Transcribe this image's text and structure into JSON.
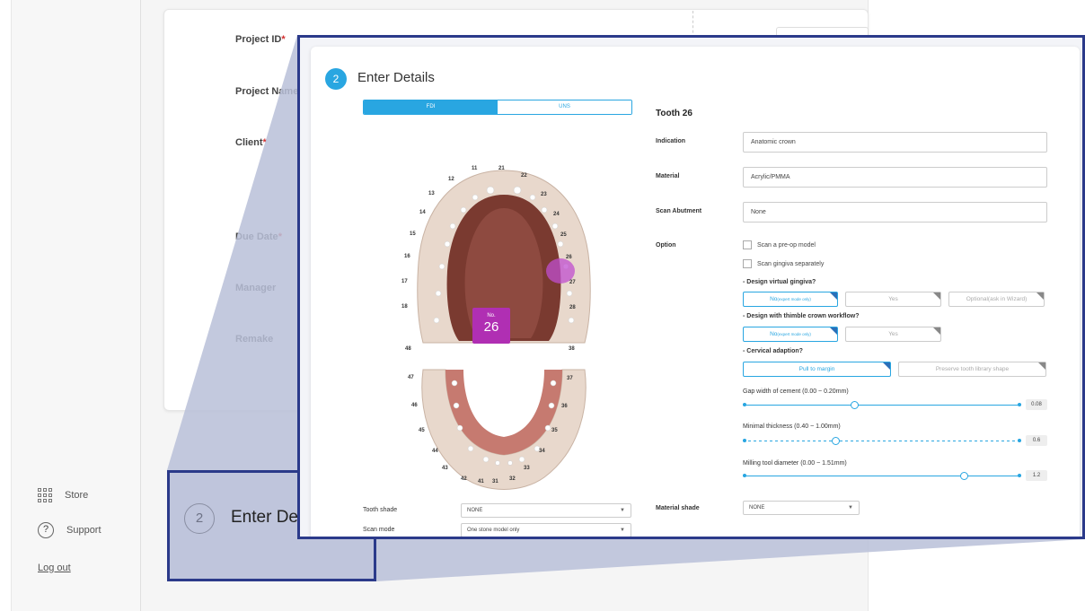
{
  "base": {
    "fields": {
      "project_id": "Project ID",
      "project_name": "Project Name",
      "client": "Client",
      "due_date": "Due Date",
      "manager": "Manager",
      "remake": "Remake",
      "required_mark": "*"
    },
    "sidebar": {
      "store": "Store",
      "support": "Support",
      "logout": "Log out"
    },
    "step_preview": {
      "number": "2",
      "title": "Enter Det"
    }
  },
  "zoom": {
    "step_number": "2",
    "step_title": "Enter Details",
    "notation_tabs": [
      "FDI",
      "UNS"
    ],
    "notation_selected": "FDI",
    "tooth_numbers": [
      "11",
      "21",
      "12",
      "22",
      "13",
      "23",
      "14",
      "24",
      "15",
      "25",
      "16",
      "26",
      "17",
      "27",
      "18",
      "28",
      "48",
      "38",
      "47",
      "37",
      "46",
      "36",
      "45",
      "35",
      "44",
      "34",
      "43",
      "33",
      "42",
      "41",
      "31",
      "32"
    ],
    "selected_badge": {
      "label": "No.",
      "value": "26"
    },
    "tooth_title": "Tooth 26",
    "indication": {
      "label": "Indication",
      "value": "Anatomic crown"
    },
    "material": {
      "label": "Material",
      "value": "Acrylic/PMMA"
    },
    "scan_abutment": {
      "label": "Scan Abutment",
      "value": "None"
    },
    "option": {
      "label": "Option",
      "checkboxes": [
        "Scan a pre-op model",
        "Scan gingiva separately"
      ],
      "virtual_gingiva": {
        "question": "- Design virtual gingiva?",
        "no": "No",
        "no_note": "(expert mode only)",
        "yes": "Yes",
        "optional": "Optional(ask in Wizard)"
      },
      "thimble": {
        "question": "- Design with thimble crown workflow?",
        "no": "No",
        "no_note": "(expert mode only)",
        "yes": "Yes"
      },
      "cervical": {
        "question": "- Cervical adaption?",
        "pull": "Pull to margin",
        "preserve": "Preserve tooth library shape"
      }
    },
    "sliders": [
      {
        "label": "Gap width of cement (0.00 ~ 0.20mm)",
        "value": "0.08",
        "fraction": 0.4
      },
      {
        "label": "Minimal thickness (0.40 ~ 1.00mm)",
        "value": "0.6",
        "fraction": 0.333
      },
      {
        "label": "Milling tool diameter (0.00 ~ 1.51mm)",
        "value": "1.2",
        "fraction": 0.795
      }
    ],
    "tooth_shade": {
      "label": "Tooth shade",
      "value": "NONE"
    },
    "scan_mode": {
      "label": "Scan mode",
      "value": "One stone model only"
    },
    "material_shade": {
      "label": "Material shade",
      "value": "NONE"
    }
  },
  "colors": {
    "accent": "#29a6e1",
    "frame": "#2b3a8a",
    "badge": "#b02fb3",
    "required": "#d32f2f"
  }
}
